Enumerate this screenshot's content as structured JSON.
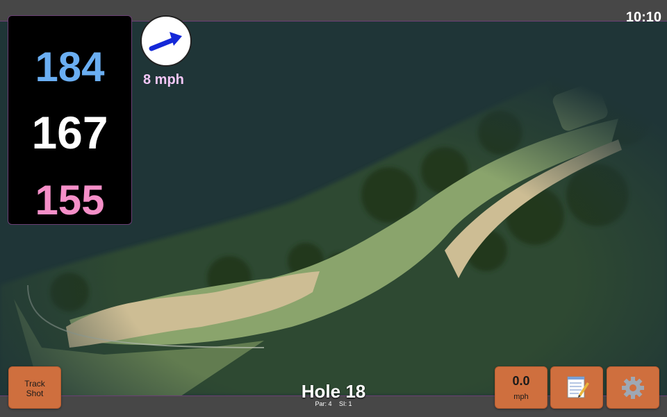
{
  "status": {
    "time": "10:10"
  },
  "distances": {
    "back": "184",
    "middle": "167",
    "front": "155"
  },
  "wind": {
    "speed": "8 mph",
    "icon": "wind-arrow-icon"
  },
  "hole": {
    "title": "Hole 18",
    "par": "Par: 4",
    "si": "SI: 1"
  },
  "buttons": {
    "track_shot": "Track\nShot",
    "speed_value": "0.0",
    "speed_unit": "mph",
    "notes_icon": "notepad-icon",
    "settings_icon": "gear-icon"
  },
  "colors": {
    "back": "#6aaef2",
    "middle": "#ffffff",
    "front": "#f58fc8",
    "button": "#cf6f3e",
    "accent": "#6b3f75"
  }
}
